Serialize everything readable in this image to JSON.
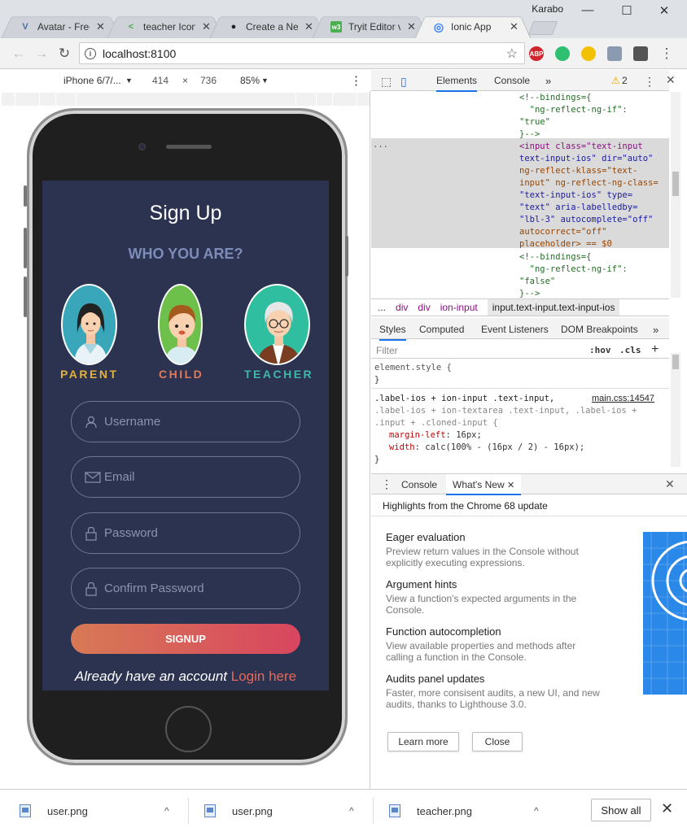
{
  "window": {
    "user": "Karabo",
    "minimize": "—",
    "maximize": "☐",
    "close": "✕"
  },
  "tabs": [
    {
      "title": "Avatar - Free",
      "favicon": "V",
      "color": "#4a6fa5"
    },
    {
      "title": "teacher Icon",
      "favicon": "<",
      "color": "#4caf50"
    },
    {
      "title": "Create a New",
      "favicon": "●",
      "color": "#222222"
    },
    {
      "title": "Tryit Editor v",
      "favicon": "w3",
      "color": "#4caf50"
    },
    {
      "title": "Ionic App",
      "favicon": "◎",
      "color": "#3880ff"
    }
  ],
  "tab_close": "✕",
  "toolbar": {
    "back": "←",
    "forward": "→",
    "reload": "↻",
    "info": "i",
    "url": "localhost:8100",
    "star": "☆",
    "menu": "⋮",
    "extensions": [
      {
        "name": "ABP",
        "color": "#d0252d"
      },
      {
        "name": "chat",
        "color": "#2fbf71"
      },
      {
        "name": "moon",
        "color": "#f2c200"
      },
      {
        "name": "down",
        "color": "#8a9bb0"
      },
      {
        "name": "tool",
        "color": "#555555"
      }
    ]
  },
  "device_toolbar": {
    "device": "iPhone 6/7/...",
    "width": "414",
    "times": "×",
    "height": "736",
    "zoom": "85%"
  },
  "app": {
    "title": "Sign Up",
    "subtitle": "WHO YOU ARE?",
    "roles": [
      {
        "label": "PARENT",
        "color": "#e3b23c",
        "bg": "#3aa6b9"
      },
      {
        "label": "CHILD",
        "color": "#e07a5a",
        "bg": "#6dc04a"
      },
      {
        "label": "TEACHER",
        "color": "#3fb8a8",
        "bg": "#2fbfa0"
      }
    ],
    "fields": [
      {
        "placeholder": "Username",
        "icon": "user-icon"
      },
      {
        "placeholder": "Email",
        "icon": "envelope-icon"
      },
      {
        "placeholder": "Password",
        "icon": "lock-icon"
      },
      {
        "placeholder": "Confirm Password",
        "icon": "lock-icon"
      }
    ],
    "signup": "SIGNUP",
    "already": "Already have an account ",
    "login": "Login here"
  },
  "devtools": {
    "tabs": [
      "Elements",
      "Console"
    ],
    "more": "»",
    "warnings": "2",
    "warning_icon": "⚠",
    "close": "✕",
    "dom_ellipsis": "...",
    "dom_lines": [
      {
        "html": "<!--bindings={",
        "kind": "cmt"
      },
      {
        "html": "  \"ng-reflect-ng-if\":",
        "kind": "cmt"
      },
      {
        "html": "\"true\"",
        "kind": "cmt"
      },
      {
        "html": "}-->",
        "kind": "cmt"
      }
    ],
    "selected_lines": [
      "<input class=\"text-input",
      "text-input-ios\" dir=\"auto\"",
      "ng-reflect-klass=\"text-",
      "input\" ng-reflect-ng-class=",
      "\"text-input-ios\" type=",
      "\"text\" aria-labelledby=",
      "\"lbl-3\" autocomplete=\"off\"",
      "autocorrect=\"off\"",
      "placeholder> == $0"
    ],
    "after_lines": [
      "<!--bindings={",
      "  \"ng-reflect-ng-if\":",
      "\"false\"",
      "}-->"
    ],
    "breadcrumbs": [
      "...",
      "div",
      "div",
      "ion-input"
    ],
    "breadcrumb_current": "input.text-input.text-input-ios",
    "style_tabs": [
      "Styles",
      "Computed",
      "Event Listeners",
      "DOM Breakpoints"
    ],
    "filter_placeholder": "Filter",
    "hov": ":hov",
    "cls": ".cls",
    "plus": "+",
    "css_element": "element.style {",
    "css_close": "}",
    "css_selector_1": ".label-ios + ion-input .text-input,",
    "css_source": "main.css:14547",
    "css_selector_2": ".label-ios + ion-textarea .text-input, .label-ios +",
    "css_selector_3": ".input + .cloned-input {",
    "css_prop_1": "margin-left",
    "css_val_1": "16px;",
    "css_prop_2": "width",
    "css_val_2": "calc(100% - (16px / 2) - 16px);",
    "drawer_tabs": [
      "Console",
      "What's New"
    ],
    "drawer_close": "✕",
    "whats_new_head": "Highlights from the Chrome 68 update",
    "features": [
      {
        "title": "Eager evaluation",
        "desc": "Preview return values in the Console without explicitly executing expressions."
      },
      {
        "title": "Argument hints",
        "desc": "View a function's expected arguments in the Console."
      },
      {
        "title": "Function autocompletion",
        "desc": "View available properties and methods after calling a function in the Console."
      },
      {
        "title": "Audits panel updates",
        "desc": "Faster, more consisent audits, a new UI, and new audits, thanks to Lighthouse 3.0."
      }
    ],
    "learn_more": "Learn more",
    "close_btn": "Close"
  },
  "downloads": {
    "files": [
      "user.png",
      "user.png",
      "teacher.png"
    ],
    "chevron": "^",
    "show_all": "Show all",
    "close": "✕"
  }
}
